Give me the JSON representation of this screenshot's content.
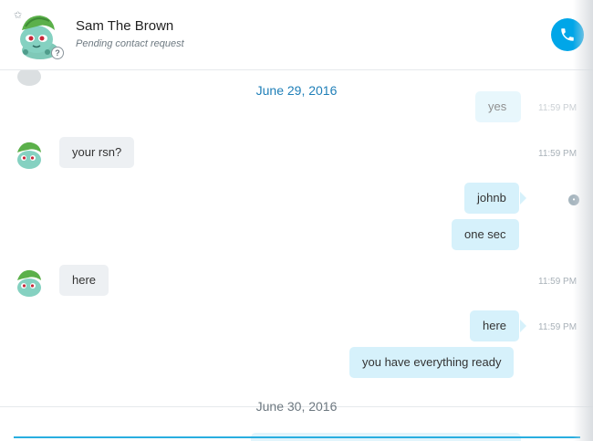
{
  "header": {
    "contact_name": "Sam The Brown",
    "contact_status": "Pending contact request"
  },
  "dates": {
    "first": "June 29, 2016",
    "second": "June 30, 2016"
  },
  "partial_top": {
    "text": "yes",
    "time": "11:59 PM"
  },
  "messages": [
    {
      "dir": "in",
      "text": "your rsn?",
      "time": "11:59 PM"
    },
    {
      "dir": "out",
      "text": "johnb"
    },
    {
      "dir": "out",
      "text": "one sec"
    },
    {
      "dir": "in",
      "text": "here",
      "time": "11:59 PM"
    },
    {
      "dir": "out",
      "text": "here",
      "time": "11:59 PM"
    },
    {
      "dir": "out",
      "text": "you have everything ready"
    }
  ],
  "colors": {
    "accent": "#00a6e8",
    "date_link": "#1f7fb8",
    "outgoing_bubble": "#d6f1fb",
    "incoming_bubble": "#edf0f3"
  },
  "icons": {
    "call": "phone-icon",
    "favorite": "star-icon",
    "pending": "question-mark-icon"
  }
}
